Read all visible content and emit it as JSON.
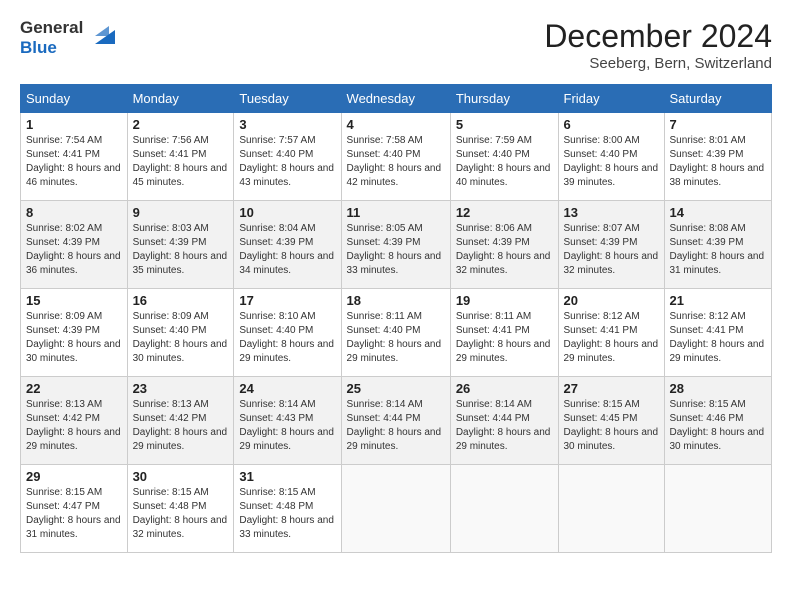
{
  "logo": {
    "general": "General",
    "blue": "Blue"
  },
  "header": {
    "month": "December 2024",
    "location": "Seeberg, Bern, Switzerland"
  },
  "days_of_week": [
    "Sunday",
    "Monday",
    "Tuesday",
    "Wednesday",
    "Thursday",
    "Friday",
    "Saturday"
  ],
  "weeks": [
    [
      {
        "day": "1",
        "sunrise": "7:54 AM",
        "sunset": "4:41 PM",
        "daylight": "8 hours and 46 minutes."
      },
      {
        "day": "2",
        "sunrise": "7:56 AM",
        "sunset": "4:41 PM",
        "daylight": "8 hours and 45 minutes."
      },
      {
        "day": "3",
        "sunrise": "7:57 AM",
        "sunset": "4:40 PM",
        "daylight": "8 hours and 43 minutes."
      },
      {
        "day": "4",
        "sunrise": "7:58 AM",
        "sunset": "4:40 PM",
        "daylight": "8 hours and 42 minutes."
      },
      {
        "day": "5",
        "sunrise": "7:59 AM",
        "sunset": "4:40 PM",
        "daylight": "8 hours and 40 minutes."
      },
      {
        "day": "6",
        "sunrise": "8:00 AM",
        "sunset": "4:40 PM",
        "daylight": "8 hours and 39 minutes."
      },
      {
        "day": "7",
        "sunrise": "8:01 AM",
        "sunset": "4:39 PM",
        "daylight": "8 hours and 38 minutes."
      }
    ],
    [
      {
        "day": "8",
        "sunrise": "8:02 AM",
        "sunset": "4:39 PM",
        "daylight": "8 hours and 36 minutes."
      },
      {
        "day": "9",
        "sunrise": "8:03 AM",
        "sunset": "4:39 PM",
        "daylight": "8 hours and 35 minutes."
      },
      {
        "day": "10",
        "sunrise": "8:04 AM",
        "sunset": "4:39 PM",
        "daylight": "8 hours and 34 minutes."
      },
      {
        "day": "11",
        "sunrise": "8:05 AM",
        "sunset": "4:39 PM",
        "daylight": "8 hours and 33 minutes."
      },
      {
        "day": "12",
        "sunrise": "8:06 AM",
        "sunset": "4:39 PM",
        "daylight": "8 hours and 32 minutes."
      },
      {
        "day": "13",
        "sunrise": "8:07 AM",
        "sunset": "4:39 PM",
        "daylight": "8 hours and 32 minutes."
      },
      {
        "day": "14",
        "sunrise": "8:08 AM",
        "sunset": "4:39 PM",
        "daylight": "8 hours and 31 minutes."
      }
    ],
    [
      {
        "day": "15",
        "sunrise": "8:09 AM",
        "sunset": "4:39 PM",
        "daylight": "8 hours and 30 minutes."
      },
      {
        "day": "16",
        "sunrise": "8:09 AM",
        "sunset": "4:40 PM",
        "daylight": "8 hours and 30 minutes."
      },
      {
        "day": "17",
        "sunrise": "8:10 AM",
        "sunset": "4:40 PM",
        "daylight": "8 hours and 29 minutes."
      },
      {
        "day": "18",
        "sunrise": "8:11 AM",
        "sunset": "4:40 PM",
        "daylight": "8 hours and 29 minutes."
      },
      {
        "day": "19",
        "sunrise": "8:11 AM",
        "sunset": "4:41 PM",
        "daylight": "8 hours and 29 minutes."
      },
      {
        "day": "20",
        "sunrise": "8:12 AM",
        "sunset": "4:41 PM",
        "daylight": "8 hours and 29 minutes."
      },
      {
        "day": "21",
        "sunrise": "8:12 AM",
        "sunset": "4:41 PM",
        "daylight": "8 hours and 29 minutes."
      }
    ],
    [
      {
        "day": "22",
        "sunrise": "8:13 AM",
        "sunset": "4:42 PM",
        "daylight": "8 hours and 29 minutes."
      },
      {
        "day": "23",
        "sunrise": "8:13 AM",
        "sunset": "4:42 PM",
        "daylight": "8 hours and 29 minutes."
      },
      {
        "day": "24",
        "sunrise": "8:14 AM",
        "sunset": "4:43 PM",
        "daylight": "8 hours and 29 minutes."
      },
      {
        "day": "25",
        "sunrise": "8:14 AM",
        "sunset": "4:44 PM",
        "daylight": "8 hours and 29 minutes."
      },
      {
        "day": "26",
        "sunrise": "8:14 AM",
        "sunset": "4:44 PM",
        "daylight": "8 hours and 29 minutes."
      },
      {
        "day": "27",
        "sunrise": "8:15 AM",
        "sunset": "4:45 PM",
        "daylight": "8 hours and 30 minutes."
      },
      {
        "day": "28",
        "sunrise": "8:15 AM",
        "sunset": "4:46 PM",
        "daylight": "8 hours and 30 minutes."
      }
    ],
    [
      {
        "day": "29",
        "sunrise": "8:15 AM",
        "sunset": "4:47 PM",
        "daylight": "8 hours and 31 minutes."
      },
      {
        "day": "30",
        "sunrise": "8:15 AM",
        "sunset": "4:48 PM",
        "daylight": "8 hours and 32 minutes."
      },
      {
        "day": "31",
        "sunrise": "8:15 AM",
        "sunset": "4:48 PM",
        "daylight": "8 hours and 33 minutes."
      },
      null,
      null,
      null,
      null
    ]
  ],
  "labels": {
    "sunrise": "Sunrise:",
    "sunset": "Sunset:",
    "daylight": "Daylight:"
  }
}
